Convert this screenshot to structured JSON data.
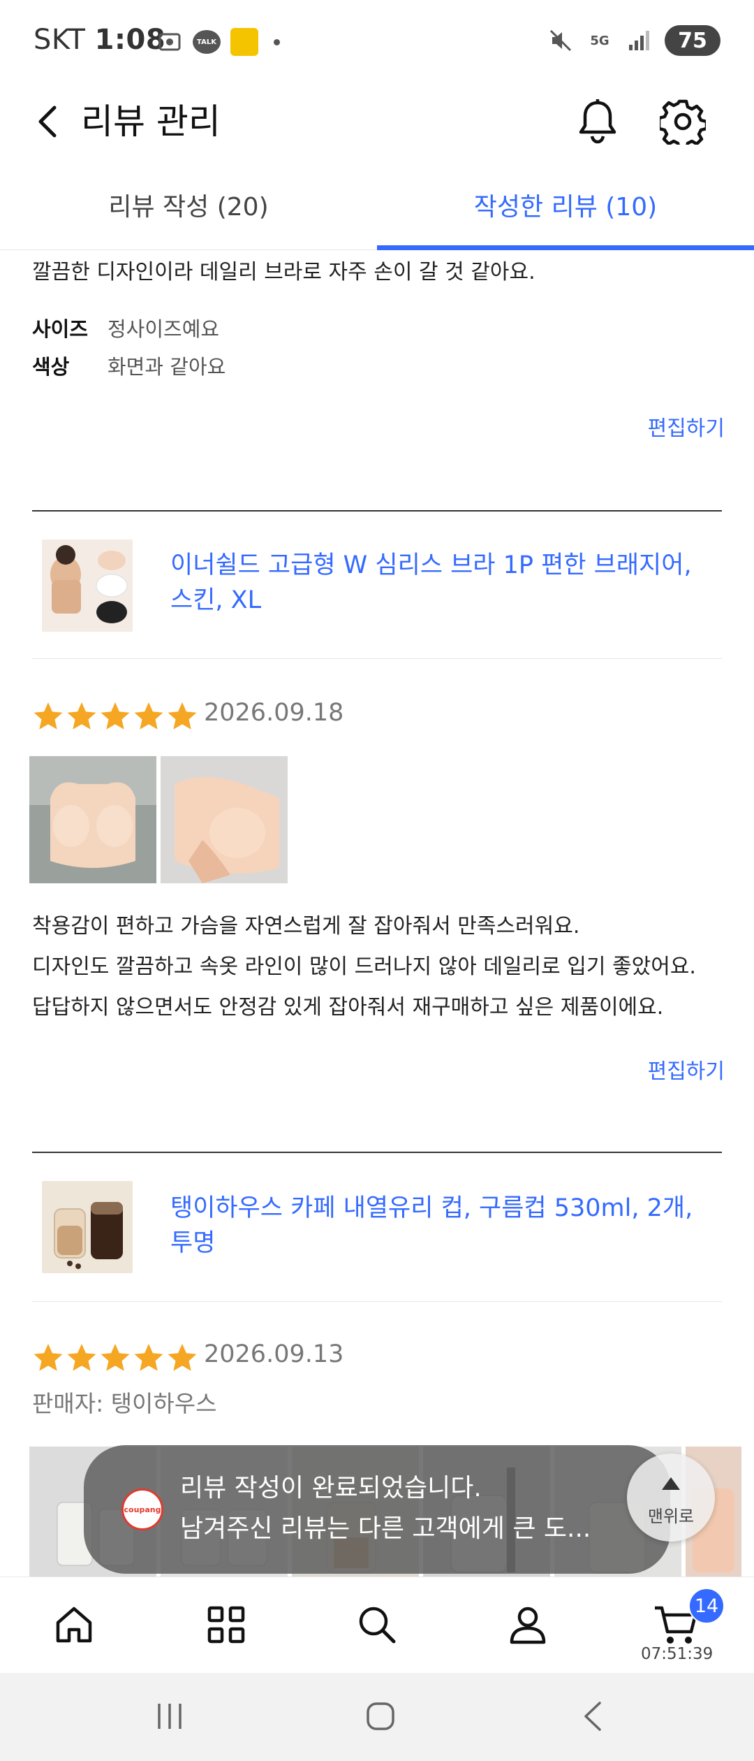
{
  "status_bar": {
    "carrier": "SKT",
    "time": "1:08",
    "talk_label": "TALK",
    "network": "5G",
    "battery": "75"
  },
  "header": {
    "title": "리뷰 관리"
  },
  "tabs": [
    {
      "label": "리뷰 작성 (20)",
      "active": false
    },
    {
      "label": "작성한 리뷰 (10)",
      "active": true
    }
  ],
  "reviews": [
    {
      "text_lines": [
        "깔끔한 디자인이라 데일리 브라로 자주 손이 갈 것 같아요."
      ],
      "attributes": [
        {
          "key": "사이즈",
          "value": "정사이즈예요"
        },
        {
          "key": "색상",
          "value": "화면과 같아요"
        }
      ],
      "edit_label": "편집하기"
    },
    {
      "product_name": "이너쉴드 고급형 W 심리스 브라 1P 편한 브래지어, 스킨, XL",
      "rating": 5,
      "date": "2026.09.18",
      "text_lines": [
        "착용감이 편하고 가슴을 자연스럽게 잘 잡아줘서 만족스러워요.",
        "디자인도 깔끔하고 속옷 라인이 많이 드러나지 않아 데일리로 입기 좋았어요.",
        "답답하지 않으면서도 안정감 있게 잡아줘서 재구매하고 싶은 제품이에요."
      ],
      "edit_label": "편집하기"
    },
    {
      "product_name": "탱이하우스 카페 내열유리 컵, 구름컵 530ml, 2개, 투명",
      "rating": 5,
      "date": "2026.09.13",
      "seller": "판매자: 탱이하우스"
    }
  ],
  "toast": {
    "logo": "coupang",
    "line1": "리뷰 작성이 완료되었습니다.",
    "line2": "남겨주신 리뷰는 다른 고객에게 큰 도..."
  },
  "scroll_top": {
    "label": "맨위로"
  },
  "bottom_nav": {
    "items": [
      "home-icon",
      "category-icon",
      "search-icon",
      "profile-icon",
      "cart-icon"
    ],
    "cart_count": "14",
    "clock": "07:51:39"
  },
  "colors": {
    "accent": "#346aff",
    "star": "#f5a623"
  }
}
